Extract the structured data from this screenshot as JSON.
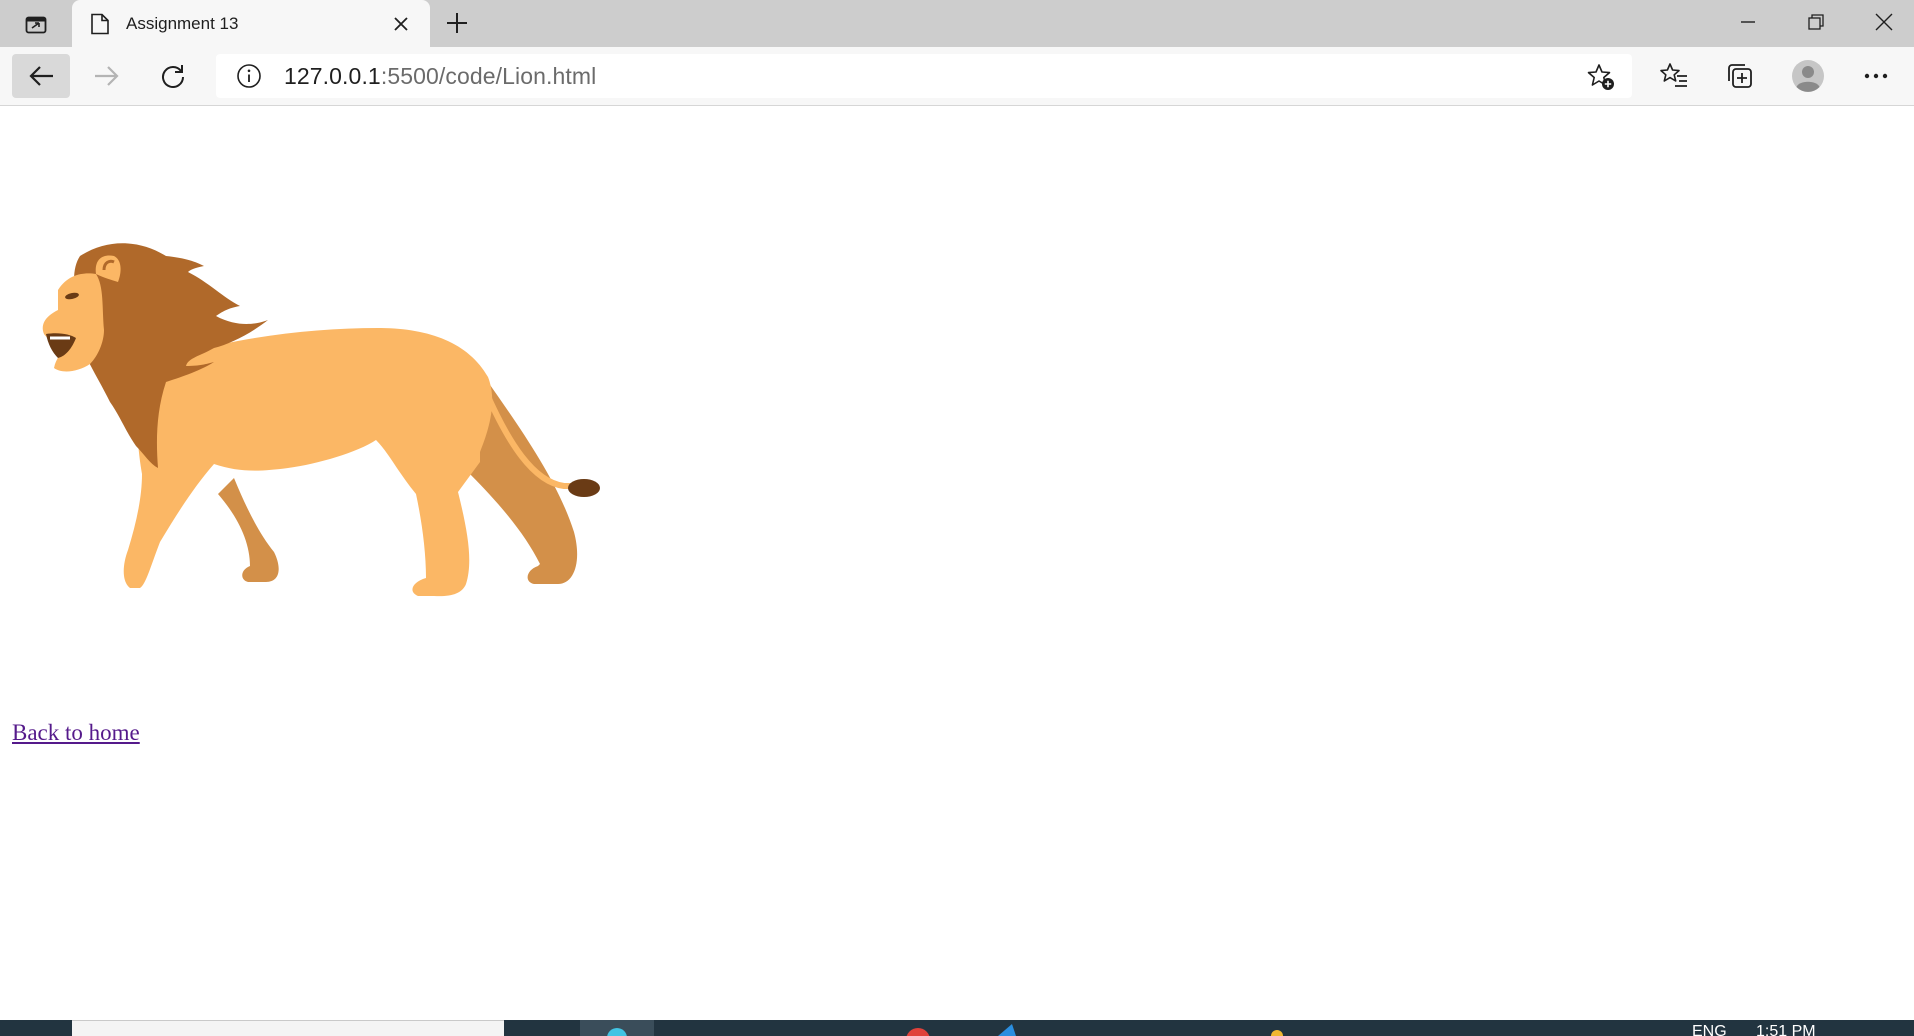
{
  "browser": {
    "tab": {
      "title": "Assignment 13"
    },
    "address": {
      "url_host": "127.0.0.1",
      "url_rest": ":5500/code/Lion.html"
    }
  },
  "page": {
    "image_alt": "lion",
    "link_text": "Back to home"
  },
  "taskbar": {
    "tray": {
      "language": "ENG",
      "time": "1:51 PM"
    }
  },
  "colors": {
    "lion_body": "#fbb765",
    "lion_mane": "#b0692a",
    "lion_shade": "#d39049",
    "lion_tail_tip": "#6a3b15",
    "link": "#551a8b"
  }
}
